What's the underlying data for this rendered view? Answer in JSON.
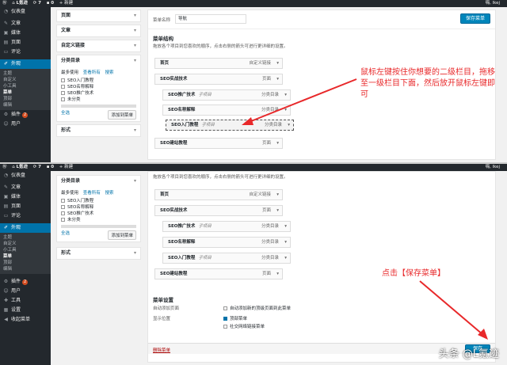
{
  "adminbar": {
    "site": "L氪迹",
    "updates": "7",
    "comments": "0",
    "new": "+ 新建",
    "greeting": "嗨, lkej"
  },
  "sidebar": {
    "items_top": [
      {
        "label": "仪表盘",
        "icon": "dashboard-icon"
      },
      {
        "label": "文章",
        "icon": "pin-icon"
      },
      {
        "label": "媒体",
        "icon": "media-icon"
      },
      {
        "label": "页面",
        "icon": "page-icon"
      },
      {
        "label": "评论",
        "icon": "comment-icon"
      }
    ],
    "current": "外观",
    "sub": [
      "主题",
      "自定义",
      "小工具",
      "菜单",
      "顶部",
      "编辑"
    ],
    "items_bottom": [
      {
        "label": "插件",
        "badge": "2"
      },
      {
        "label": "用户"
      },
      {
        "label": "工具"
      },
      {
        "label": "设置"
      },
      {
        "label": "收起菜单"
      }
    ]
  },
  "left": {
    "pages": "页面",
    "posts": "文章",
    "custom_links": "自定义链接",
    "categories": "分类目录",
    "tabs": [
      "最多使用",
      "查看所有",
      "搜索"
    ],
    "cat_items": [
      "SEO入门教程",
      "SEO名称解释",
      "SEO推广技术",
      "未分类"
    ],
    "select_all": "全选",
    "add_button": "添加到菜单",
    "formats": "形式"
  },
  "main": {
    "menu_name_label": "菜单名称",
    "menu_name_value": "导航",
    "save_button": "保存菜单",
    "structure_title": "菜单结构",
    "structure_desc": "拖放各个项目到您喜欢的顺序，点击右侧的箭头可进行更详细的设置。",
    "item_home": "首页",
    "type_custom": "自定义链接",
    "item_seo": "SEO实战技术",
    "type_page": "页面",
    "sub_label": "子项目",
    "type_cat": "分类目录",
    "item_promo": "SEO推广技术",
    "item_names": "SEO名称解释",
    "item_intro": "SEO入门教程",
    "item_site": "SEO建站教程",
    "settings_title": "菜单设置",
    "auto_add_label": "自动添加页面",
    "auto_add_text": "自动添加新的顶级页面到此菜单",
    "location_label": "显示位置",
    "loc_top": "顶部菜单",
    "loc_social": "社交网络链接菜单",
    "delete": "删除菜单",
    "save_partial": "保存"
  },
  "annotations": {
    "a1": "鼠标左键按住你想要的二级栏目，拖移至一级栏目下面，然后放开鼠标左键即可",
    "a2": "点击【保存菜单】"
  },
  "watermark": "头条 @L氪迹",
  "colors": {
    "accent": "#0085ba",
    "annotation": "#e8282a",
    "sidebar": "#23282d"
  }
}
